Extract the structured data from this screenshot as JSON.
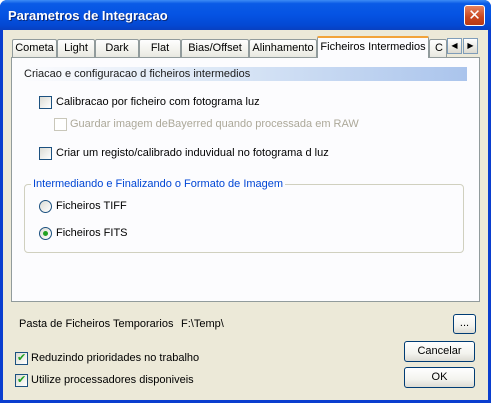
{
  "window": {
    "title": "Parametros de Integracao",
    "close_glyph": "✕"
  },
  "tabs": [
    {
      "label": "Cometa"
    },
    {
      "label": "Light"
    },
    {
      "label": "Dark"
    },
    {
      "label": "Flat"
    },
    {
      "label": "Bias/Offset"
    },
    {
      "label": "Alinhamento"
    },
    {
      "label": "Ficheiros Intermedios",
      "active": true
    },
    {
      "label": "C"
    }
  ],
  "tab_scroll": {
    "left": "◀",
    "right": "▶"
  },
  "panel": {
    "section_title": "Criacao e configuracao d ficheiros intermedios",
    "calibrate_per_file": {
      "label": "Calibracao por ficheiro com fotograma luz",
      "checked": false
    },
    "save_debayered": {
      "label": "Guardar imagem deBayerred quando processada em RAW",
      "checked": false,
      "enabled": false
    },
    "individual_record": {
      "label": "Criar um registo/calibrado induvidual no fotograma d luz",
      "checked": false
    },
    "format_group": {
      "title": "Intermediando e Finalizando o Formato de Imagem",
      "options": [
        {
          "label": "Ficheiros TIFF",
          "selected": false
        },
        {
          "label": "Ficheiros FITS",
          "selected": true
        }
      ]
    }
  },
  "temp_folder": {
    "label": "Pasta de Ficheiros Temporarios",
    "value": "F:\\Temp\\",
    "browse_label": "..."
  },
  "options": {
    "reduce_priority": {
      "label": "Reduzindo prioridades no trabalho",
      "checked": true
    },
    "use_processors": {
      "label": "Utilize processadores disponiveis",
      "checked": true
    }
  },
  "buttons": {
    "cancel": "Cancelar",
    "ok": "OK"
  },
  "colors": {
    "accent_tab": "#f2a33a",
    "group_title": "#0046d5",
    "check_mark": "#21a121"
  }
}
